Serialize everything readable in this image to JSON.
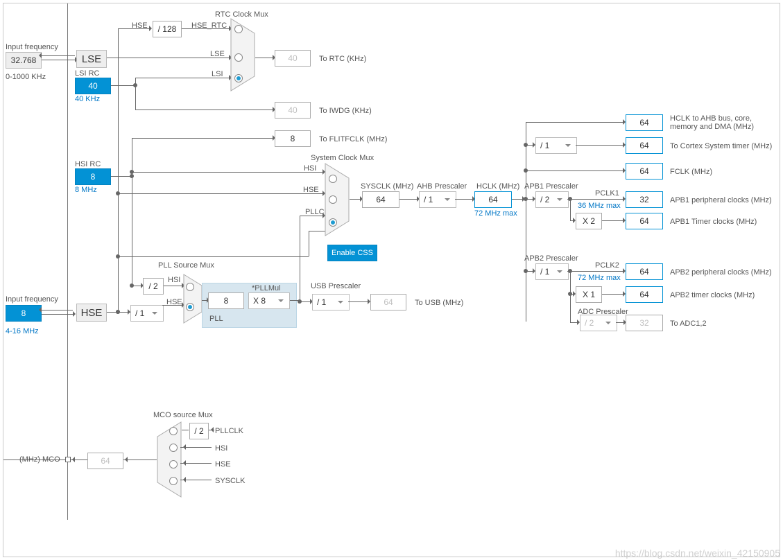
{
  "watermark": "https://blog.csdn.net/weixin_42150905",
  "inputs": {
    "lse_freq_label": "Input frequency",
    "lse_freq_value": "32.768",
    "lse_freq_range": "0-1000 KHz",
    "lse_block": "LSE",
    "lsi_title": "LSI RC",
    "lsi_value": "40",
    "lsi_note": "40 KHz",
    "hsi_title": "HSI RC",
    "hsi_value": "8",
    "hsi_note": "8 MHz",
    "hse_freq_label": "Input frequency",
    "hse_freq_value": "8",
    "hse_freq_range": "4-16 MHz",
    "hse_block": "HSE"
  },
  "rtc": {
    "title": "RTC Clock Mux",
    "hse": "HSE",
    "hse_div": "/ 128",
    "hse_rtc": "HSE_RTC",
    "lse": "LSE",
    "lsi": "LSI",
    "to_rtc_val": "40",
    "to_rtc_lbl": "To RTC (KHz)"
  },
  "iwdg": {
    "val": "40",
    "lbl": "To IWDG (KHz)"
  },
  "flitf": {
    "val": "8",
    "lbl": "To FLITFCLK (MHz)"
  },
  "sysmux": {
    "title": "System Clock Mux",
    "hsi": "HSI",
    "hse": "HSE",
    "pllclk": "PLLCLK",
    "enable_css": "Enable CSS"
  },
  "pll": {
    "title": "PLL Source Mux",
    "hsi": "HSI",
    "hse": "HSE",
    "div2": "/ 2",
    "hse_presc": "/ 1",
    "pll_in": "8",
    "pllmul_lbl": "*PLLMul",
    "pllmul": "X 8",
    "pll_label": "PLL"
  },
  "usb": {
    "title": "USB Prescaler",
    "presc": "/ 1",
    "val": "64",
    "lbl": "To USB (MHz)"
  },
  "sysline": {
    "sysclk_lbl": "SYSCLK (MHz)",
    "sysclk_val": "64",
    "ahb_lbl": "AHB Prescaler",
    "ahb_presc": "/ 1",
    "hclk_lbl": "HCLK (MHz)",
    "hclk_val": "64",
    "hclk_max": "72 MHz max"
  },
  "right": {
    "hclk_out": "64",
    "hclk_out_lbl": "HCLK to AHB bus, core, memory and DMA (MHz)",
    "cortex_presc": "/ 1",
    "cortex_val": "64",
    "cortex_lbl": "To Cortex System timer (MHz)",
    "fclk_val": "64",
    "fclk_lbl": "FCLK (MHz)",
    "apb1_title": "APB1 Prescaler",
    "apb1_presc": "/ 2",
    "apb1_max": "36 MHz max",
    "pclk1": "PCLK1",
    "apb1_periph_val": "32",
    "apb1_periph_lbl": "APB1 peripheral clocks (MHz)",
    "apb1_tim_mul": "X 2",
    "apb1_tim_val": "64",
    "apb1_tim_lbl": "APB1 Timer clocks (MHz)",
    "apb2_title": "APB2 Prescaler",
    "apb2_presc": "/ 1",
    "apb2_max": "72 MHz max",
    "pclk2": "PCLK2",
    "apb2_periph_val": "64",
    "apb2_periph_lbl": "APB2 peripheral clocks (MHz)",
    "apb2_tim_mul": "X 1",
    "apb2_tim_val": "64",
    "apb2_tim_lbl": "APB2 timer clocks (MHz)",
    "adc_title": "ADC Prescaler",
    "adc_presc": "/ 2",
    "adc_val": "32",
    "adc_lbl": "To ADC1,2"
  },
  "mco": {
    "title": "MCO source Mux",
    "pllclk": "PLLCLK",
    "div2": "/ 2",
    "hsi": "HSI",
    "hse": "HSE",
    "sysclk": "SYSCLK",
    "out": "64",
    "out_lbl": "(MHz) MCO"
  }
}
